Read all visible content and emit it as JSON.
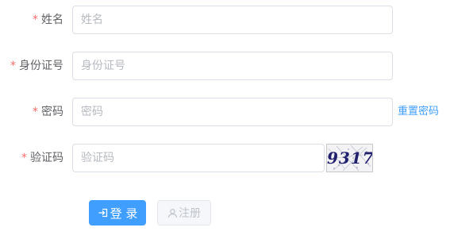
{
  "form": {
    "name": {
      "required_mark": "*",
      "label": "姓名",
      "placeholder": "姓名",
      "value": ""
    },
    "id_number": {
      "required_mark": "*",
      "label": "身份证号",
      "placeholder": "身份证号",
      "value": ""
    },
    "password": {
      "required_mark": "*",
      "label": "密码",
      "placeholder": "密码",
      "value": "",
      "reset_link": "重置密码"
    },
    "captcha": {
      "required_mark": "*",
      "label": "验证码",
      "placeholder": "验证码",
      "value": "",
      "image_text": "9317"
    }
  },
  "buttons": {
    "login_label": "登 录",
    "login_icon": "login-icon",
    "register_label": "注册",
    "register_icon": "user-icon"
  },
  "colors": {
    "primary": "#409eff",
    "required": "#f56c6c",
    "label": "#606266",
    "border": "#dcdfe6",
    "placeholder": "#b7bac1",
    "disabled_text": "#c0c4cc"
  }
}
